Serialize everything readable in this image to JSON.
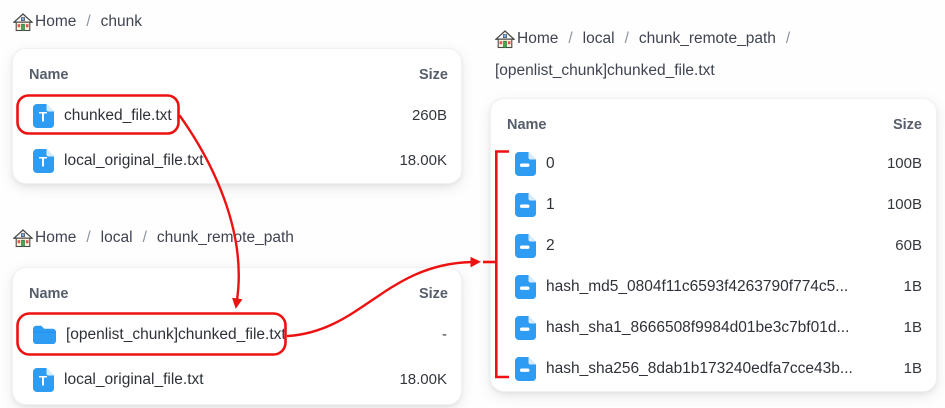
{
  "ui": {
    "separator": "/"
  },
  "colors": {
    "icon_blue": "#2f9cf4",
    "annotation_red": "#ee1111",
    "card_background": "#ffffff"
  },
  "panels": [
    {
      "breadcrumb": [
        "Home",
        "chunk"
      ],
      "headers": {
        "name": "Name",
        "size": "Size"
      },
      "rows": [
        {
          "icon": "text-file-icon",
          "name": "chunked_file.txt",
          "size": "260B",
          "highlighted": true
        },
        {
          "icon": "text-file-icon",
          "name": "local_original_file.txt",
          "size": "18.00K",
          "highlighted": false
        }
      ]
    },
    {
      "breadcrumb": [
        "Home",
        "local",
        "chunk_remote_path"
      ],
      "headers": {
        "name": "Name",
        "size": "Size"
      },
      "rows": [
        {
          "icon": "folder-icon",
          "name": "[openlist_chunk]chunked_file.txt",
          "size": "-",
          "highlighted": true
        },
        {
          "icon": "text-file-icon",
          "name": "local_original_file.txt",
          "size": "18.00K",
          "highlighted": false
        }
      ]
    },
    {
      "breadcrumb": [
        "Home",
        "local",
        "chunk_remote_path",
        "[openlist_chunk]chunked_file.txt"
      ],
      "headers": {
        "name": "Name",
        "size": "Size"
      },
      "rows": [
        {
          "icon": "chunk-file-icon",
          "name": "0",
          "size": "100B",
          "bracketed": true
        },
        {
          "icon": "chunk-file-icon",
          "name": "1",
          "size": "100B",
          "bracketed": true
        },
        {
          "icon": "chunk-file-icon",
          "name": "2",
          "size": "60B",
          "bracketed": true
        },
        {
          "icon": "chunk-file-icon",
          "name": "hash_md5_0804f11c6593f4263790f774c5...",
          "size": "1B",
          "bracketed": true
        },
        {
          "icon": "chunk-file-icon",
          "name": "hash_sha1_8666508f9984d01be3c7bf01d...",
          "size": "1B",
          "bracketed": true
        },
        {
          "icon": "chunk-file-icon",
          "name": "hash_sha256_8dab1b173240edfa7cce43b...",
          "size": "1B",
          "bracketed": true
        }
      ]
    }
  ]
}
